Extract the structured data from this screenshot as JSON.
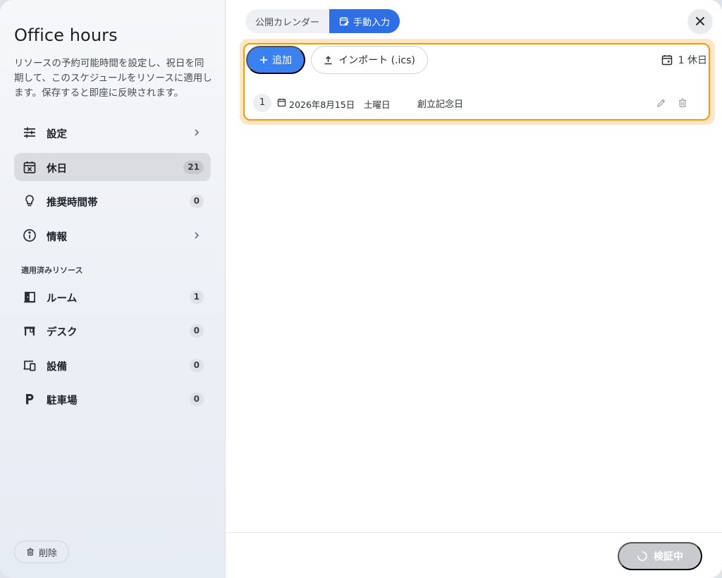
{
  "sidebar": {
    "title": "Office hours",
    "description": "リソースの予約可能時間を設定し、祝日を同期して、このスケジュールをリソースに適用します。保存すると即座に反映されます。",
    "nav": [
      {
        "label": "設定",
        "icon": "sliders-icon",
        "chevron": true
      },
      {
        "label": "休日",
        "icon": "calendar-x-icon",
        "badge": "21",
        "active": true
      },
      {
        "label": "推奨時間帯",
        "icon": "lightbulb-icon",
        "badge": "0"
      },
      {
        "label": "情報",
        "icon": "info-icon",
        "chevron": true
      }
    ],
    "section_label": "適用済みリソース",
    "resources": [
      {
        "label": "ルーム",
        "icon": "door-icon",
        "badge": "1"
      },
      {
        "label": "デスク",
        "icon": "desk-icon",
        "badge": "0"
      },
      {
        "label": "設備",
        "icon": "devices-icon",
        "badge": "0"
      },
      {
        "label": "駐車場",
        "icon": "parking-icon",
        "badge": "0"
      }
    ],
    "delete_label": "削除"
  },
  "tabs": {
    "public_calendar": "公開カレンダー",
    "manual_input": "手動入力",
    "active": "manual_input"
  },
  "toolbar": {
    "add_label": "追加",
    "import_label": "インポート (.ics)",
    "count_label": "1 休日"
  },
  "holidays": [
    {
      "index": "1",
      "date": "2026年8月15日",
      "weekday": "土曜日",
      "name": "創立記念日"
    }
  ],
  "footer": {
    "verify_label": "検証中"
  },
  "colors": {
    "accent": "#3b82f0",
    "tab_active": "#2f6fe6",
    "highlight_border": "#f19a14",
    "disabled_button": "#c8cacd"
  }
}
